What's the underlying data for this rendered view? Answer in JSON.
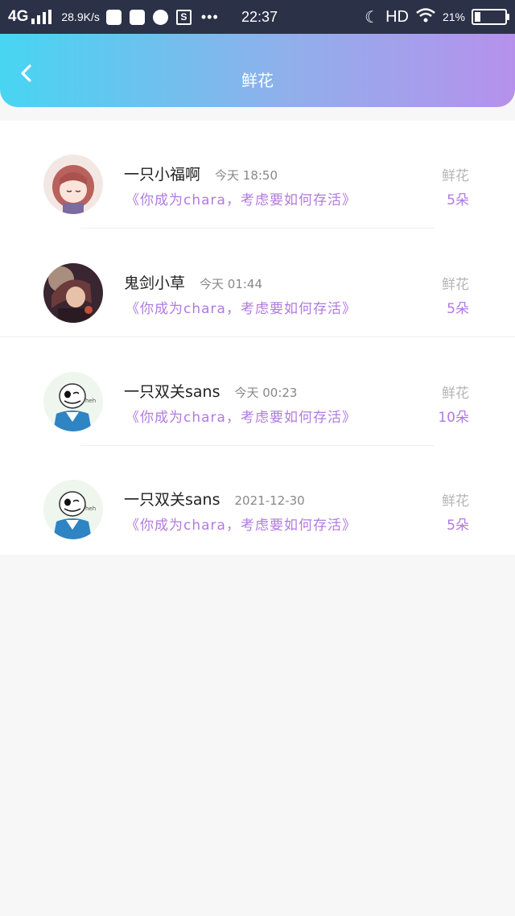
{
  "status_bar": {
    "network": "4G",
    "speed": "28.9K/s",
    "time": "22:37",
    "hd": "HD",
    "battery": "21%",
    "battery_level": 0.21
  },
  "header": {
    "title": "鲜花"
  },
  "records": [
    {
      "name": "一只小福啊",
      "time": "今天 18:50",
      "book": "《你成为chara，考虑要如何存活》",
      "gift_label": "鲜花",
      "gift_count": "5朵",
      "avatar": "anime-girl-avatar"
    },
    {
      "name": "鬼剑小草",
      "time": "今天 01:44",
      "book": "《你成为chara，考虑要如何存活》",
      "gift_label": "鲜花",
      "gift_count": "5朵",
      "avatar": "dark-anime-avatar"
    },
    {
      "name": "一只双关sans",
      "time": "今天 00:23",
      "book": "《你成为chara，考虑要如何存活》",
      "gift_label": "鲜花",
      "gift_count": "10朵",
      "avatar": "sans-skeleton-avatar"
    },
    {
      "name": "一只双关sans",
      "time": "2021-12-30",
      "book": "《你成为chara，考虑要如何存活》",
      "gift_label": "鲜花",
      "gift_count": "5朵",
      "avatar": "sans-skeleton-avatar"
    }
  ],
  "colors": {
    "header_gradient_start": "#47d5f2",
    "header_gradient_end": "#b691ec",
    "book_title": "#b27ae0",
    "muted": "#b5b5b5"
  }
}
